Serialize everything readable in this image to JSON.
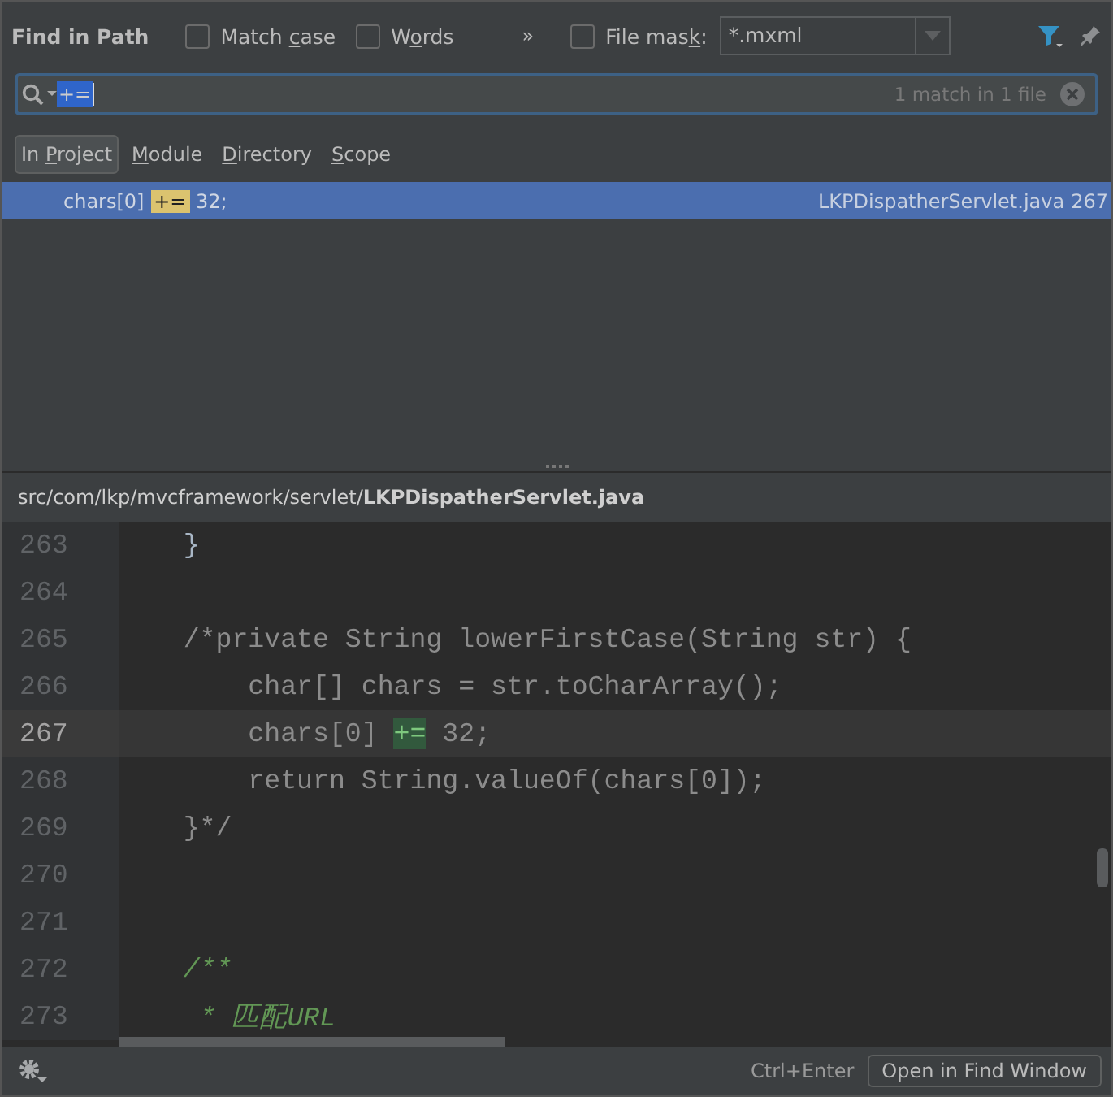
{
  "header": {
    "title": "Find in Path",
    "options": [
      {
        "before": "Match ",
        "mnemonic": "c",
        "after": "ase",
        "checked": false
      },
      {
        "before": "W",
        "mnemonic": "o",
        "after": "rds",
        "checked": false
      }
    ],
    "more": "»",
    "file_mask": {
      "before": "File mas",
      "mnemonic": "k",
      "after": ":",
      "checked": false,
      "value": "*.mxml"
    }
  },
  "search": {
    "value": "+=",
    "selected_text": true,
    "result_count": "1 match in 1 file"
  },
  "scopes": [
    {
      "before": "In ",
      "mnemonic": "P",
      "after": "roject",
      "selected": true
    },
    {
      "mnemonic": "M",
      "after": "odule",
      "selected": false
    },
    {
      "mnemonic": "D",
      "after": "irectory",
      "selected": false
    },
    {
      "mnemonic": "S",
      "after": "cope",
      "selected": false
    }
  ],
  "results": [
    {
      "selected": true,
      "text": "chars[0] ",
      "match": "+=",
      "text_after": " 32;",
      "file": "LKPDispatherServlet.java",
      "line": "267"
    }
  ],
  "preview": {
    "path": "src/com/lkp/mvcframework/servlet/**LKPDispatherServlet.java**",
    "lines": [
      {
        "number": "263",
        "kind": "code",
        "current": false,
        "text": "    }"
      },
      {
        "number": "264",
        "current": false
      },
      {
        "number": "265",
        "kind": "comment",
        "current": false,
        "text": "    /*private String lowerFirstCase(String str) {"
      },
      {
        "number": "266",
        "kind": "comment",
        "current": false,
        "text": "        char[] chars = str.toCharArray();"
      },
      {
        "number": "267",
        "kind": "comment",
        "current": true,
        "text": "        chars[0] ",
        "match": "+=",
        "text_after": " 32;"
      },
      {
        "number": "268",
        "kind": "comment",
        "current": false,
        "text": "        return String.valueOf(chars[0]);"
      },
      {
        "number": "269",
        "kind": "comment",
        "current": false,
        "text": "    }*/"
      },
      {
        "number": "270",
        "current": false
      },
      {
        "number": "271",
        "current": false
      },
      {
        "number": "272",
        "kind": "doc",
        "current": false,
        "text": "    /**"
      },
      {
        "number": "273",
        "kind": "doc",
        "current": false,
        "text": "     * 匹配URL"
      }
    ]
  },
  "footer": {
    "shortcut": "Ctrl+Enter",
    "button": "Open in Find Window"
  }
}
